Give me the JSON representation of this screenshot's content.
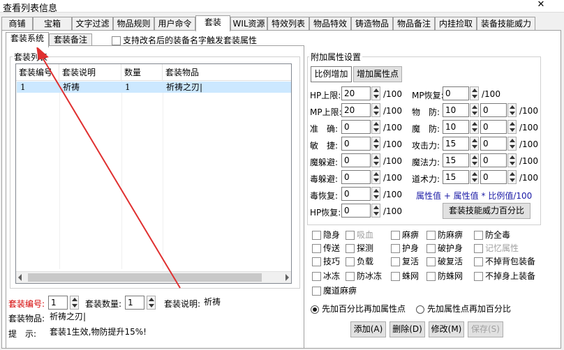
{
  "window": {
    "title": "查看列表信息",
    "close": "✕"
  },
  "tabs": [
    "商铺",
    "宝箱",
    "文字过滤",
    "物品规则",
    "用户命令",
    "套装",
    "WIL资源",
    "特效列表",
    "物品特效",
    "铸造物品",
    "物品备注",
    "内挂捡取",
    "装备技能威力"
  ],
  "subtabs": [
    "套装系统",
    "套装备注"
  ],
  "support_rename": "支持改名后的装备名字触发套装属性",
  "suit_list": {
    "label": "套装列表",
    "columns": [
      "套装编号",
      "套装说明",
      "数量",
      "套装物品"
    ],
    "rows": [
      {
        "id": "1",
        "desc": "祈祷",
        "count": "1",
        "items": "祈祷之刃|"
      }
    ]
  },
  "form": {
    "id_label": "套装编号:",
    "id_value": "1",
    "count_label": "套装数量:",
    "count_value": "1",
    "desc_label": "套装说明:",
    "desc_value": "祈祷",
    "items_label": "套装物品:",
    "items_value": "祈祷之刃|",
    "hint_label": "提　示:",
    "hint_value": "套装1生效,物防提升15%!"
  },
  "attr": {
    "group_label": "附加属性设置",
    "btn_ratio": "比例增加",
    "btn_points": "增加属性点",
    "unit": "/100",
    "hp_max": {
      "label": "HP上限:",
      "value": "20"
    },
    "mp_max": {
      "label": "MP上限:",
      "value": "20"
    },
    "acc": {
      "label": "准　确:",
      "value": "0"
    },
    "agi": {
      "label": "敏　捷:",
      "value": "0"
    },
    "mdodge": {
      "label": "魔躲避:",
      "value": "0"
    },
    "pdodge": {
      "label": "毒躲避:",
      "value": "0"
    },
    "precover": {
      "label": "毒恢复:",
      "value": "0"
    },
    "hprecover": {
      "label": "HP恢复:",
      "value": "0"
    },
    "mprecover": {
      "label": "MP恢复:",
      "value": "0"
    },
    "pdef": {
      "label": "物　防:",
      "v1": "10",
      "v2": "0"
    },
    "mdef": {
      "label": "魔　防:",
      "v1": "10",
      "v2": "0"
    },
    "atk": {
      "label": "攻击力:",
      "v1": "15",
      "v2": "0"
    },
    "mag": {
      "label": "魔法力:",
      "v1": "15",
      "v2": "0"
    },
    "tao": {
      "label": "道术力:",
      "v1": "15",
      "v2": "0"
    },
    "formula": "属性值 + 属性值 * 比例值/100",
    "skill_btn": "套装技能威力百分比"
  },
  "flags": [
    [
      "隐身",
      "吸血",
      "麻痹",
      "防麻痹",
      "防全毒"
    ],
    [
      "传送",
      "探测",
      "护身",
      "破护身",
      "记忆属性"
    ],
    [
      "技巧",
      "负载",
      "复活",
      "破复活",
      "不掉背包装备"
    ],
    [
      "冰冻",
      "防冰冻",
      "蛛网",
      "防蛛网",
      "不掉身上装备"
    ],
    [
      "魔道麻痹"
    ]
  ],
  "radio": {
    "opt1": "先加百分比再加属性点",
    "opt2": "先加属性点再加百分比"
  },
  "buttons": {
    "add": "添加(A)",
    "delete": "删除(D)",
    "modify": "修改(M)",
    "save": "保存(S)"
  },
  "colors": {
    "red_label": "#d40000",
    "formula": "#1a1aa6",
    "annotation_arrow": "#e03030"
  }
}
